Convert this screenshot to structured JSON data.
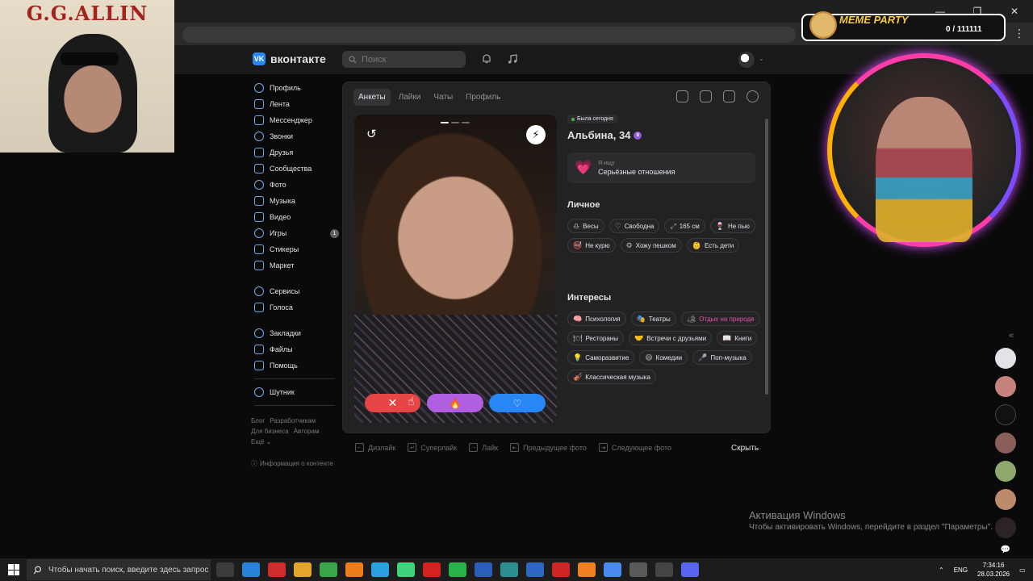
{
  "browser": {
    "window_controls": [
      "—",
      "❐",
      "✕"
    ],
    "menu_glyph": "⋮"
  },
  "overlay_image": {
    "title": "G.G.ALLIN"
  },
  "meme_widget": {
    "title": "MEME PARTY",
    "counter": "0 / 111111"
  },
  "header": {
    "logo_text": "вконтакте",
    "logo_mark": "VK",
    "search_placeholder": "Поиск",
    "caret": "⌄"
  },
  "sidebar": {
    "items": [
      {
        "label": "Профиль",
        "icon": "user-circle-icon"
      },
      {
        "label": "Лента",
        "icon": "feed-icon"
      },
      {
        "label": "Мессенджер",
        "icon": "message-icon"
      },
      {
        "label": "Звонки",
        "icon": "phone-icon"
      },
      {
        "label": "Друзья",
        "icon": "friends-icon"
      },
      {
        "label": "Сообщества",
        "icon": "communities-icon"
      },
      {
        "label": "Фото",
        "icon": "photo-icon"
      },
      {
        "label": "Музыка",
        "icon": "music-icon"
      },
      {
        "label": "Видео",
        "icon": "video-icon"
      },
      {
        "label": "Игры",
        "icon": "games-icon",
        "badge": "1"
      },
      {
        "label": "Стикеры",
        "icon": "sticker-icon"
      },
      {
        "label": "Маркет",
        "icon": "market-icon"
      }
    ],
    "items2": [
      {
        "label": "Сервисы",
        "icon": "services-icon"
      },
      {
        "label": "Голоса",
        "icon": "coins-icon"
      }
    ],
    "items3": [
      {
        "label": "Закладки",
        "icon": "bookmark-icon"
      },
      {
        "label": "Файлы",
        "icon": "file-icon"
      },
      {
        "label": "Помощь",
        "icon": "help-icon"
      }
    ],
    "items4": [
      {
        "label": "Шутник",
        "icon": "group-icon"
      }
    ],
    "footer": {
      "blog": "Блог",
      "developers": "Разработчикам",
      "business": "Для бизнеса",
      "authors": "Авторам",
      "more": "Ещё ⌄"
    },
    "content_info": "Информация о контенте"
  },
  "dating": {
    "tabs": [
      "Анкеты",
      "Лайки",
      "Чаты",
      "Профиль"
    ],
    "active_tab": 0,
    "photo_count": 3,
    "active_photo": 0,
    "status": "Была сегодня",
    "name": "Альбина, 34",
    "looking_for_label": "Я ищу",
    "looking_for_value": "Серьёзные отношения",
    "personal_title": "Личное",
    "personal": [
      {
        "glyph": "♎",
        "label": "Весы"
      },
      {
        "glyph": "♡",
        "label": "Свободна"
      },
      {
        "glyph": "⤢",
        "label": "165 см"
      },
      {
        "glyph": "🍷",
        "label": "Не пью"
      },
      {
        "glyph": "🚭",
        "label": "Не курю"
      },
      {
        "glyph": "⚙",
        "label": "Хожу пешком"
      },
      {
        "glyph": "👶",
        "label": "Есть дети"
      }
    ],
    "interests_title": "Интересы",
    "interests": [
      {
        "glyph": "🧠",
        "label": "Психология"
      },
      {
        "glyph": "🎭",
        "label": "Театры"
      },
      {
        "glyph": "🏕",
        "label": "Отдых на природе",
        "highlight": true
      },
      {
        "glyph": "🍽",
        "label": "Рестораны"
      },
      {
        "glyph": "🤝",
        "label": "Встречи с друзьями"
      },
      {
        "glyph": "📖",
        "label": "Книги"
      },
      {
        "glyph": "💡",
        "label": "Саморазвитие"
      },
      {
        "glyph": "😄",
        "label": "Комедии"
      },
      {
        "glyph": "🎤",
        "label": "Поп-музыка"
      },
      {
        "glyph": "🎻",
        "label": "Классическая музыка"
      }
    ],
    "buttons": {
      "undo": "↺",
      "boost": "⚡",
      "dislike": "✕",
      "superlike": "🔥",
      "like": "♡"
    },
    "hints": [
      {
        "key": "←",
        "label": "Дизлайк"
      },
      {
        "key": "↵",
        "label": "Суперлайк"
      },
      {
        "key": "→",
        "label": "Лайк"
      },
      {
        "key": "⇤",
        "label": "Предыдущее фото"
      },
      {
        "key": "⇥",
        "label": "Следующее фото"
      }
    ],
    "hide": "Скрыть"
  },
  "rail": {
    "collapse": "«",
    "chat": "💬"
  },
  "windows_activation": {
    "title": "Активация Windows",
    "text": "Чтобы активировать Windows, перейдите в раздел \"Параметры\"."
  },
  "taskbar": {
    "search_placeholder": "Чтобы начать поиск, введите здесь запрос",
    "tray_caret": "⌃",
    "lang": "ENG",
    "time": "7:34:16",
    "date": "28.03.2026",
    "icon_colors": [
      "#3b3b3b",
      "#2a82d8",
      "#d22b2b",
      "#e3a52b",
      "#3aa64a",
      "#f07d1a",
      "#2aa1de",
      "#3ed27a",
      "#d6221e",
      "#2ab24a",
      "#2b5eb8",
      "#2b8f8f",
      "#2d67c4",
      "#cf2525",
      "#f08020",
      "#4a8af0",
      "#5a5a5a",
      "#444",
      "#5865f2"
    ]
  }
}
